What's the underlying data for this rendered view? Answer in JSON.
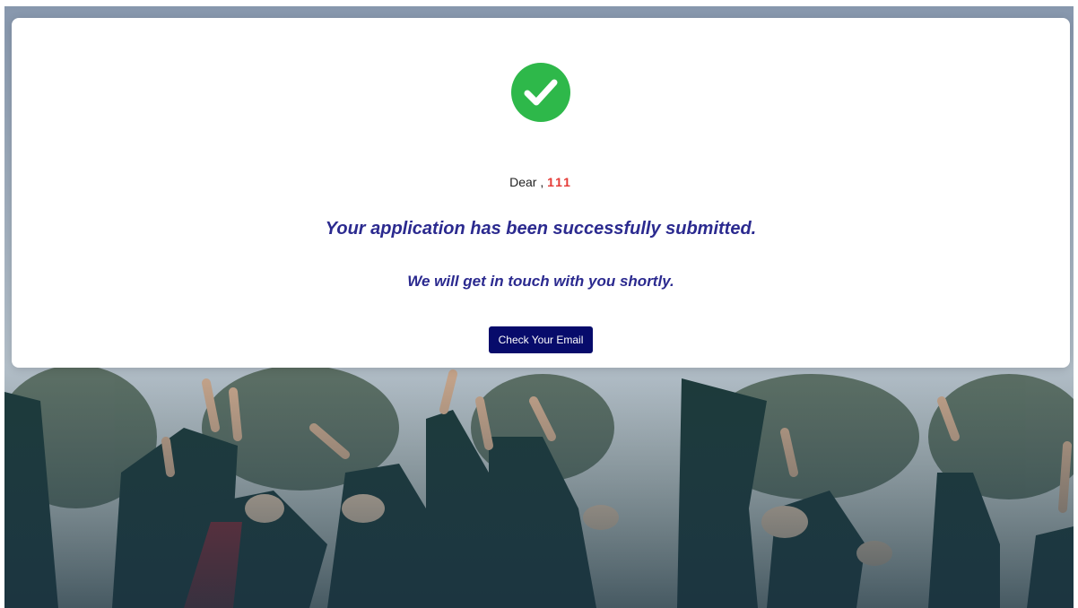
{
  "background": {
    "description_icon": "graduation-photo"
  },
  "card": {
    "icon": "check-circle-icon",
    "greeting_prefix": "Dear ,",
    "name": "111",
    "headline": "Your application has been successfully submitted.",
    "subline": "We will get in touch with you shortly.",
    "button_label": "Check Your Email"
  },
  "colors": {
    "success": "#2eb84a",
    "name": "#e53935",
    "headline": "#2b2a8f",
    "button": "#070b6b"
  }
}
